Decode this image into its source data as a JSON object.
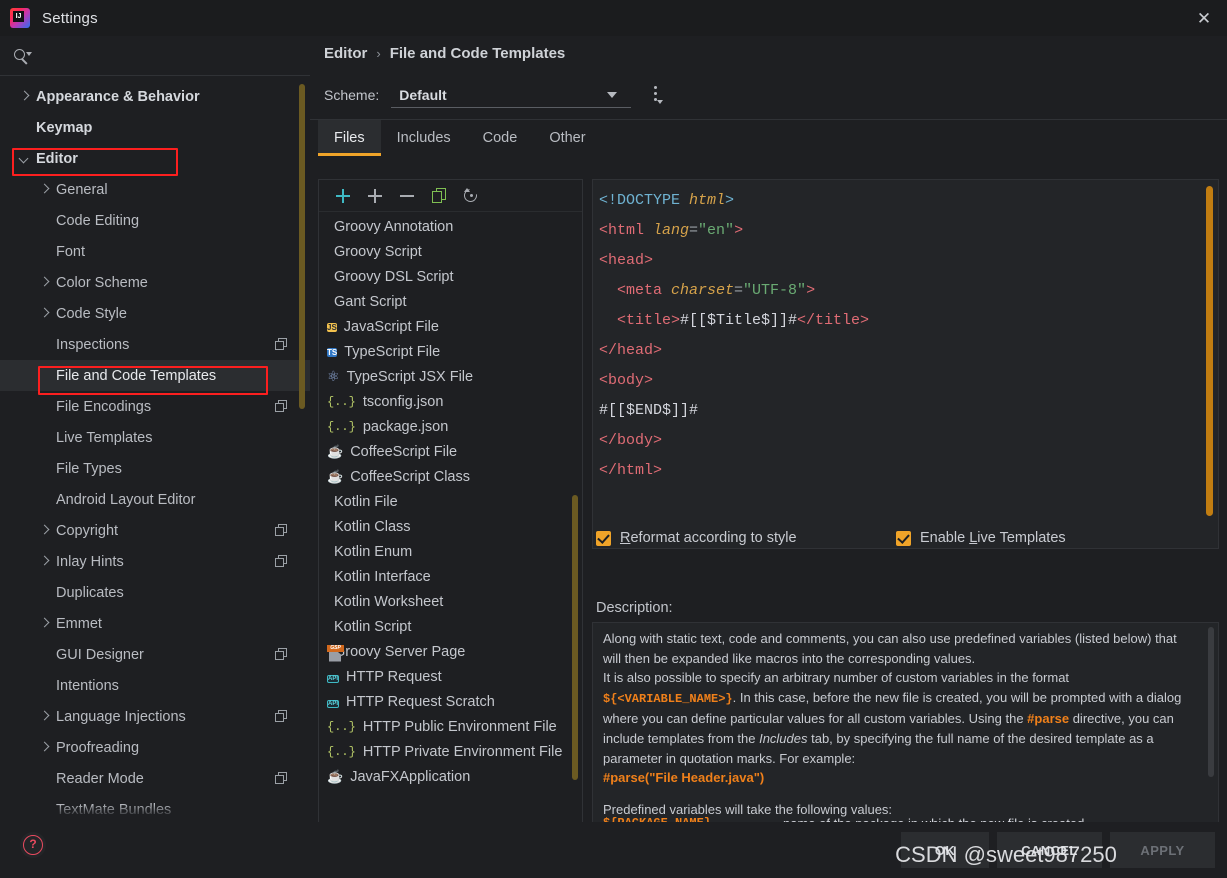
{
  "window": {
    "title": "Settings",
    "logo_icon": "intellij-idea-logo",
    "close_icon": "close-icon"
  },
  "search": {
    "icon": "search-icon",
    "value": "",
    "placeholder": ""
  },
  "sidebar": {
    "items": [
      {
        "label": "Appearance & Behavior",
        "level": 0,
        "arrow": "right",
        "bold": true,
        "badge": false,
        "selected": false
      },
      {
        "label": "Keymap",
        "level": 0,
        "arrow": "none",
        "bold": true,
        "badge": false,
        "selected": false
      },
      {
        "label": "Editor",
        "level": 0,
        "arrow": "down",
        "bold": true,
        "badge": false,
        "selected": false,
        "annotated": true
      },
      {
        "label": "General",
        "level": 1,
        "arrow": "right",
        "bold": false,
        "badge": false,
        "selected": false
      },
      {
        "label": "Code Editing",
        "level": 1,
        "arrow": "none",
        "bold": false,
        "badge": false,
        "selected": false
      },
      {
        "label": "Font",
        "level": 1,
        "arrow": "none",
        "bold": false,
        "badge": false,
        "selected": false
      },
      {
        "label": "Color Scheme",
        "level": 1,
        "arrow": "right",
        "bold": false,
        "badge": false,
        "selected": false
      },
      {
        "label": "Code Style",
        "level": 1,
        "arrow": "right",
        "bold": false,
        "badge": false,
        "selected": false
      },
      {
        "label": "Inspections",
        "level": 1,
        "arrow": "none",
        "bold": false,
        "badge": true,
        "selected": false
      },
      {
        "label": "File and Code Templates",
        "level": 1,
        "arrow": "none",
        "bold": false,
        "badge": false,
        "selected": true,
        "annotated": true
      },
      {
        "label": "File Encodings",
        "level": 1,
        "arrow": "none",
        "bold": false,
        "badge": true,
        "selected": false
      },
      {
        "label": "Live Templates",
        "level": 1,
        "arrow": "none",
        "bold": false,
        "badge": false,
        "selected": false
      },
      {
        "label": "File Types",
        "level": 1,
        "arrow": "none",
        "bold": false,
        "badge": false,
        "selected": false
      },
      {
        "label": "Android Layout Editor",
        "level": 1,
        "arrow": "none",
        "bold": false,
        "badge": false,
        "selected": false
      },
      {
        "label": "Copyright",
        "level": 1,
        "arrow": "right",
        "bold": false,
        "badge": true,
        "selected": false
      },
      {
        "label": "Inlay Hints",
        "level": 1,
        "arrow": "right",
        "bold": false,
        "badge": true,
        "selected": false
      },
      {
        "label": "Duplicates",
        "level": 1,
        "arrow": "none",
        "bold": false,
        "badge": false,
        "selected": false
      },
      {
        "label": "Emmet",
        "level": 1,
        "arrow": "right",
        "bold": false,
        "badge": false,
        "selected": false
      },
      {
        "label": "GUI Designer",
        "level": 1,
        "arrow": "none",
        "bold": false,
        "badge": true,
        "selected": false
      },
      {
        "label": "Intentions",
        "level": 1,
        "arrow": "none",
        "bold": false,
        "badge": false,
        "selected": false
      },
      {
        "label": "Language Injections",
        "level": 1,
        "arrow": "right",
        "bold": false,
        "badge": true,
        "selected": false
      },
      {
        "label": "Proofreading",
        "level": 1,
        "arrow": "right",
        "bold": false,
        "badge": false,
        "selected": false
      },
      {
        "label": "Reader Mode",
        "level": 1,
        "arrow": "none",
        "bold": false,
        "badge": true,
        "selected": false
      },
      {
        "label": "TextMate Bundles",
        "level": 1,
        "arrow": "none",
        "bold": false,
        "badge": false,
        "selected": false
      }
    ]
  },
  "header": {
    "breadcrumb_parent": "Editor",
    "breadcrumb_sep": "›",
    "breadcrumb_current": "File and Code Templates",
    "scheme_label": "Scheme:",
    "scheme_value": "Default",
    "scheme_caret_icon": "chevron-down-icon",
    "scheme_more_icon": "more-options-icon"
  },
  "tabs": [
    {
      "label": "Files",
      "active": true
    },
    {
      "label": "Includes",
      "active": false
    },
    {
      "label": "Code",
      "active": false
    },
    {
      "label": "Other",
      "active": false
    }
  ],
  "list_toolbar": [
    {
      "name": "create-template-button",
      "icon": "plus-accent-icon"
    },
    {
      "name": "add-button",
      "icon": "plus-icon"
    },
    {
      "name": "remove-button",
      "icon": "minus-icon"
    },
    {
      "name": "copy-template-button",
      "icon": "copy-icon"
    },
    {
      "name": "reset-to-default-button",
      "icon": "reset-icon"
    }
  ],
  "templates": [
    {
      "label": "Groovy Annotation",
      "icon": "groovy-file-icon"
    },
    {
      "label": "Groovy Script",
      "icon": "groovy-file-icon"
    },
    {
      "label": "Groovy DSL Script",
      "icon": "groovy-file-icon"
    },
    {
      "label": "Gant Script",
      "icon": "groovy-file-icon"
    },
    {
      "label": "JavaScript File",
      "icon": "javascript-file-icon"
    },
    {
      "label": "TypeScript File",
      "icon": "typescript-file-icon"
    },
    {
      "label": "TypeScript JSX File",
      "icon": "react-jsx-file-icon"
    },
    {
      "label": "tsconfig.json",
      "icon": "json-file-icon"
    },
    {
      "label": "package.json",
      "icon": "json-file-icon"
    },
    {
      "label": "CoffeeScript File",
      "icon": "coffeescript-file-icon"
    },
    {
      "label": "CoffeeScript Class",
      "icon": "coffeescript-file-icon"
    },
    {
      "label": "Kotlin File",
      "icon": "kotlin-file-icon"
    },
    {
      "label": "Kotlin Class",
      "icon": "kotlin-file-icon"
    },
    {
      "label": "Kotlin Enum",
      "icon": "kotlin-file-icon"
    },
    {
      "label": "Kotlin Interface",
      "icon": "kotlin-file-icon"
    },
    {
      "label": "Kotlin Worksheet",
      "icon": "kotlin-file-icon"
    },
    {
      "label": "Kotlin Script",
      "icon": "kotlin-file-icon"
    },
    {
      "label": "Groovy Server Page",
      "icon": "gsp-file-icon"
    },
    {
      "label": "HTTP Request",
      "icon": "http-request-icon"
    },
    {
      "label": "HTTP Request Scratch",
      "icon": "http-request-icon"
    },
    {
      "label": "HTTP Public Environment File",
      "icon": "json-file-icon"
    },
    {
      "label": "HTTP Private Environment File",
      "icon": "json-file-icon"
    },
    {
      "label": "JavaFXApplication",
      "icon": "java-file-icon"
    }
  ],
  "editor": {
    "lines": [
      [
        {
          "t": "<!DOCTYPE ",
          "c": "t-dtd"
        },
        {
          "t": "html",
          "c": "t-dtdname"
        },
        {
          "t": ">",
          "c": "t-dtd"
        }
      ],
      [
        {
          "t": "<html ",
          "c": "t-tag"
        },
        {
          "t": "lang",
          "c": "t-attr"
        },
        {
          "t": "=",
          "c": "t-punct"
        },
        {
          "t": "\"en\"",
          "c": "t-val"
        },
        {
          "t": ">",
          "c": "t-tag"
        }
      ],
      [
        {
          "t": "<head>",
          "c": "t-tag"
        }
      ],
      [
        {
          "t": "  <meta ",
          "c": "t-tag"
        },
        {
          "t": "charset",
          "c": "t-attr"
        },
        {
          "t": "=",
          "c": "t-punct"
        },
        {
          "t": "\"UTF-8\"",
          "c": "t-val"
        },
        {
          "t": ">",
          "c": "t-tag"
        }
      ],
      [
        {
          "t": "  <title>",
          "c": "t-tag"
        },
        {
          "t": "#[[$Title$]]#",
          "c": "t-plain"
        },
        {
          "t": "</title>",
          "c": "t-tag"
        }
      ],
      [
        {
          "t": "</head>",
          "c": "t-tag"
        }
      ],
      [
        {
          "t": "<body>",
          "c": "t-tag"
        }
      ],
      [
        {
          "t": "#[[$END$]]#",
          "c": "t-plain"
        }
      ],
      [
        {
          "t": "</body>",
          "c": "t-tag"
        }
      ],
      [
        {
          "t": "</html>",
          "c": "t-tag"
        }
      ]
    ]
  },
  "options": {
    "reformat": {
      "label_pre": "",
      "mnemonic": "R",
      "label_post": "eformat according to style",
      "checked": true
    },
    "live_templates": {
      "label_pre": "Enable ",
      "mnemonic": "L",
      "label_post": "ive Templates",
      "checked": true
    }
  },
  "description": {
    "label": "Description:",
    "para1_a": "Along with static text, code and comments, you can also use predefined variables (listed below) that will then be expanded like macros into the corresponding values.",
    "para2_a": "It is also possible to specify an arbitrary number of custom variables in the format ",
    "para2_code": "${<VARIABLE_NAME>}",
    "para2_b": ". In this case, before the new file is created, you will be prompted with a dialog where you can define particular values for all custom variables. Using the ",
    "para2_code2": "#parse",
    "para2_c": " directive, you can include templates from the ",
    "para2_italic": "Includes",
    "para2_d": " tab, by specifying the full name of the desired template as a parameter in quotation marks. For example:",
    "para3_code": "#parse(\"File Header.java\")",
    "para4": "Predefined variables will take the following values:",
    "var_name": "${PACKAGE_NAME}",
    "var_desc": "name of the package in which the new file is created"
  },
  "footer": {
    "help_icon": "help-icon",
    "ok_label": "OK",
    "cancel_label": "CANCEL",
    "apply_label": "APPLY"
  },
  "watermark": {
    "text": "CSDN @sweet987250"
  }
}
